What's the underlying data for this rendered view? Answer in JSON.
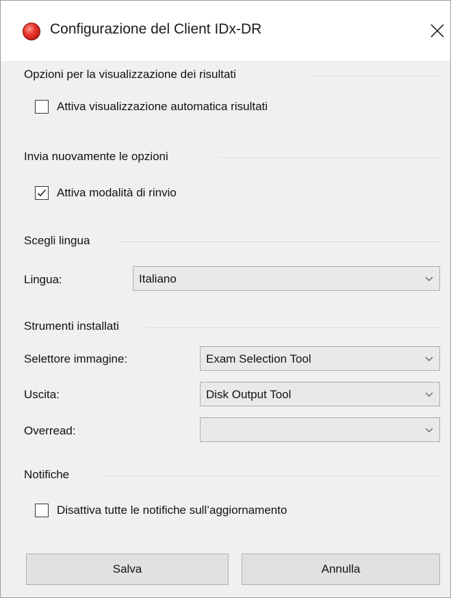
{
  "window": {
    "title": "Configurazione del Client IDx-DR",
    "icon": "app-red-ball-icon",
    "close_glyph": "✕"
  },
  "results_display": {
    "heading": "Opzioni per la visualizzazione dei risultati",
    "auto_display": {
      "label": "Attiva visualizzazione automatica risultati",
      "checked": false
    }
  },
  "resend": {
    "heading": "Invia nuovamente le opzioni",
    "resend_mode": {
      "label": "Attiva modalità di rinvio",
      "checked": true
    }
  },
  "language": {
    "heading": "Scegli lingua",
    "label": "Lingua:",
    "selected": "Italiano"
  },
  "tools": {
    "heading": "Strumenti installati",
    "image_selector": {
      "label": "Selettore immagine:",
      "selected": "Exam Selection Tool"
    },
    "output": {
      "label": "Uscita:",
      "selected": "Disk Output Tool"
    },
    "overread": {
      "label": "Overread:",
      "selected": ""
    }
  },
  "notifications": {
    "heading": "Notifiche",
    "disable_updates": {
      "label": "Disattiva tutte le notifiche sull’aggiornamento",
      "checked": false
    }
  },
  "buttons": {
    "save": "Salva",
    "cancel": "Annulla"
  },
  "colors": {
    "dialog_bg": "#f0f0f0",
    "titlebar_bg": "#ffffff",
    "button_bg": "#e1e1e1",
    "icon_red": "#e8332a"
  }
}
